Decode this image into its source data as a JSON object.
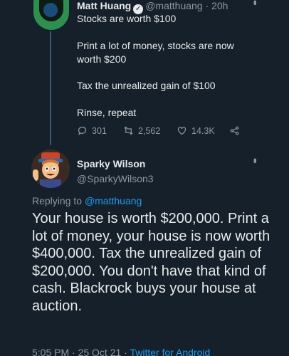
{
  "parent_tweet": {
    "author_name": "Matt Huang",
    "handle": "@matthuang",
    "separator": " · ",
    "time": "20h",
    "lines": [
      "Stocks are worth $100",
      "Print a lot of money, stocks are now worth $200",
      "Tax the unrealized gain of $100",
      "Rinse, repeat"
    ],
    "stats": {
      "replies": "301",
      "retweets": "2,562",
      "likes": "14.3K"
    }
  },
  "reply_tweet": {
    "author_name": "Sparky Wilson",
    "handle": "@SparkyWilson3",
    "replying_prefix": "Replying to ",
    "replying_handle": "@matthuang",
    "text": "Your house is worth $200,000. Print a lot of money, your house is now worth $400,000.  Tax the unrealized gain of $200,000. You don't have that kind of cash. Blackrock buys your house at auction.",
    "timestamp": "5:05 PM · 25 Oct 21 · ",
    "source": "Twitter for Android"
  },
  "colors": {
    "background": "#15202b",
    "link": "#1d9bf0",
    "muted": "#8b98a5"
  },
  "icons": [
    "more-icon",
    "verified-icon",
    "reply-icon",
    "retweet-icon",
    "like-icon",
    "share-icon"
  ]
}
